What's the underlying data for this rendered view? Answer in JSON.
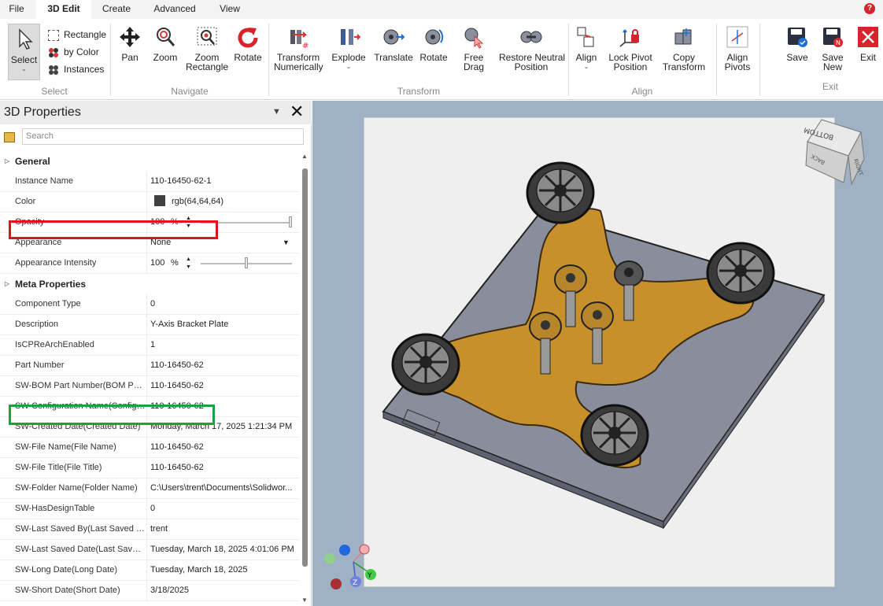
{
  "menu": {
    "tabs": [
      "File",
      "3D Edit",
      "Create",
      "Advanced",
      "View"
    ],
    "active": "3D Edit",
    "help": "?"
  },
  "ribbon": {
    "select": {
      "label": "Select",
      "rectangle": "Rectangle",
      "by_color": "by Color",
      "instances": "Instances",
      "group": "Select"
    },
    "navigate": {
      "pan": "Pan",
      "zoom": "Zoom",
      "zoom_rect_1": "Zoom",
      "zoom_rect_2": "Rectangle",
      "rotate": "Rotate",
      "group": "Navigate"
    },
    "transform": {
      "tn_1": "Transform",
      "tn_2": "Numerically",
      "explode": "Explode",
      "translate": "Translate",
      "rotate": "Rotate",
      "free_1": "Free",
      "free_2": "Drag",
      "restore_1": "Restore Neutral",
      "restore_2": "Position",
      "group": "Transform"
    },
    "align": {
      "align": "Align",
      "lock_1": "Lock Pivot",
      "lock_2": "Position",
      "copy_1": "Copy",
      "copy_2": "Transform",
      "pivots_1": "Align",
      "pivots_2": "Pivots",
      "group": "Align"
    },
    "exit": {
      "save": "Save",
      "save_new_1": "Save",
      "save_new_2": "New",
      "exit": "Exit",
      "group": "Exit"
    }
  },
  "panel": {
    "title": "3D Properties",
    "search_placeholder": "Search"
  },
  "general": {
    "title": "General",
    "rows": [
      {
        "key": "Instance Name",
        "value": "110-16450-62-1"
      },
      {
        "key": "Color",
        "value": "rgb(64,64,64)"
      },
      {
        "key": "Opacity",
        "value": "100",
        "unit": "%"
      },
      {
        "key": "Appearance",
        "value": "None"
      },
      {
        "key": "Appearance Intensity",
        "value": "100",
        "unit": "%"
      }
    ]
  },
  "meta": {
    "title": "Meta Properties",
    "rows": [
      {
        "key": "Component Type",
        "value": "0"
      },
      {
        "key": "Description",
        "value": "Y-Axis Bracket Plate"
      },
      {
        "key": "IsCPReArchEnabled",
        "value": "1"
      },
      {
        "key": "Part Number",
        "value": "110-16450-62"
      },
      {
        "key": "SW-BOM Part Number(BOM Part...",
        "value": "110-16450-62"
      },
      {
        "key": "SW-Configuration Name(Configu...",
        "value": "110-16450-62"
      },
      {
        "key": "SW-Created Date(Created Date)",
        "value": "Monday, March 17, 2025 1:21:34 PM"
      },
      {
        "key": "SW-File Name(File Name)",
        "value": "110-16450-62"
      },
      {
        "key": "SW-File Title(File Title)",
        "value": "110-16450-62"
      },
      {
        "key": "SW-Folder Name(Folder Name)",
        "value": "C:\\Users\\trent\\Documents\\Solidwor..."
      },
      {
        "key": "SW-HasDesignTable",
        "value": "0"
      },
      {
        "key": "SW-Last Saved By(Last Saved By)",
        "value": "trent"
      },
      {
        "key": "SW-Last Saved Date(Last Saved ...",
        "value": "Tuesday, March 18, 2025 4:01:06 PM"
      },
      {
        "key": "SW-Long Date(Long Date)",
        "value": "Tuesday, March 18, 2025"
      },
      {
        "key": "SW-Short Date(Short Date)",
        "value": "3/18/2025"
      }
    ]
  },
  "viewcube": {
    "top": "BOTTOM",
    "right": "RIGHT",
    "left": "BACK"
  },
  "triad": {
    "y": "Y",
    "z": "Z"
  },
  "colors": {
    "accent": "#1e6fd9",
    "highlight_red": "#e0121a",
    "highlight_green": "#18a43a",
    "plate": "#c8902a",
    "base": "#8a8e9c"
  }
}
